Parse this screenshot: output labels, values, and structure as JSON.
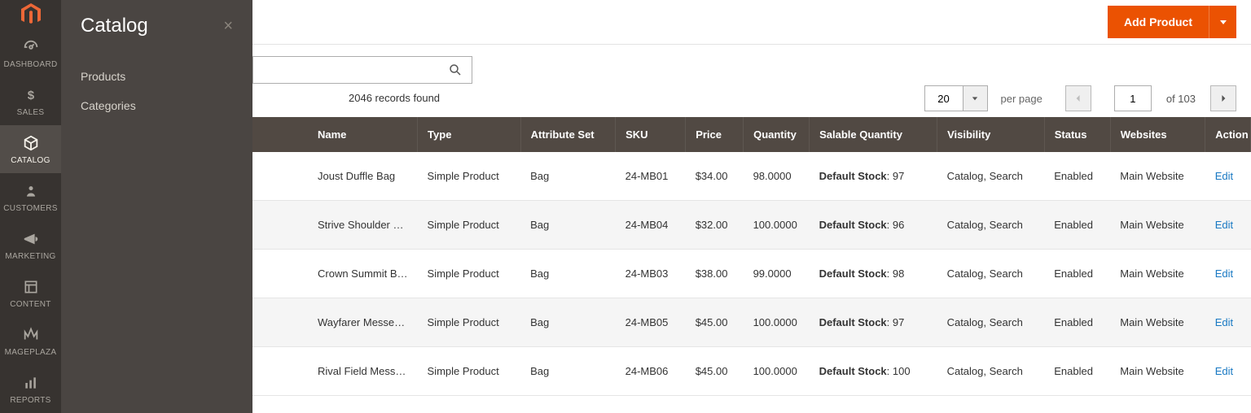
{
  "rail": {
    "items": [
      {
        "id": "dashboard",
        "label": "DASHBOARD"
      },
      {
        "id": "sales",
        "label": "SALES"
      },
      {
        "id": "catalog",
        "label": "CATALOG"
      },
      {
        "id": "customers",
        "label": "CUSTOMERS"
      },
      {
        "id": "marketing",
        "label": "MARKETING"
      },
      {
        "id": "content",
        "label": "CONTENT"
      },
      {
        "id": "mageplaza",
        "label": "MAGEPLAZA"
      },
      {
        "id": "reports",
        "label": "REPORTS"
      }
    ]
  },
  "flyout": {
    "title": "Catalog",
    "items": [
      {
        "label": "Products"
      },
      {
        "label": "Categories"
      }
    ]
  },
  "header": {
    "add_label": "Add Product"
  },
  "toolbar": {
    "records_found": "2046 records found",
    "per_page_value": "20",
    "per_page_label": "per page",
    "page_value": "1",
    "page_of": "of 103"
  },
  "grid": {
    "columns": {
      "name": "Name",
      "type": "Type",
      "attribute_set": "Attribute Set",
      "sku": "SKU",
      "price": "Price",
      "quantity": "Quantity",
      "salable_quantity": "Salable Quantity",
      "visibility": "Visibility",
      "status": "Status",
      "websites": "Websites",
      "action": "Action"
    },
    "salable_label": "Default Stock",
    "edit_label": "Edit",
    "rows": [
      {
        "name": "Joust Duffle Bag",
        "type": "Simple Product",
        "attr": "Bag",
        "sku": "24-MB01",
        "price": "$34.00",
        "qty": "98.0000",
        "salable": "97",
        "visibility": "Catalog, Search",
        "status": "Enabled",
        "websites": "Main Website"
      },
      {
        "name": "Strive Shoulder Pack",
        "type": "Simple Product",
        "attr": "Bag",
        "sku": "24-MB04",
        "price": "$32.00",
        "qty": "100.0000",
        "salable": "96",
        "visibility": "Catalog, Search",
        "status": "Enabled",
        "websites": "Main Website"
      },
      {
        "name": "Crown Summit Backpack",
        "type": "Simple Product",
        "attr": "Bag",
        "sku": "24-MB03",
        "price": "$38.00",
        "qty": "99.0000",
        "salable": "98",
        "visibility": "Catalog, Search",
        "status": "Enabled",
        "websites": "Main Website"
      },
      {
        "name": "Wayfarer Messenger Bag",
        "type": "Simple Product",
        "attr": "Bag",
        "sku": "24-MB05",
        "price": "$45.00",
        "qty": "100.0000",
        "salable": "97",
        "visibility": "Catalog, Search",
        "status": "Enabled",
        "websites": "Main Website"
      },
      {
        "name": "Rival Field Messenger",
        "type": "Simple Product",
        "attr": "Bag",
        "sku": "24-MB06",
        "price": "$45.00",
        "qty": "100.0000",
        "salable": "100",
        "visibility": "Catalog, Search",
        "status": "Enabled",
        "websites": "Main Website"
      }
    ]
  }
}
